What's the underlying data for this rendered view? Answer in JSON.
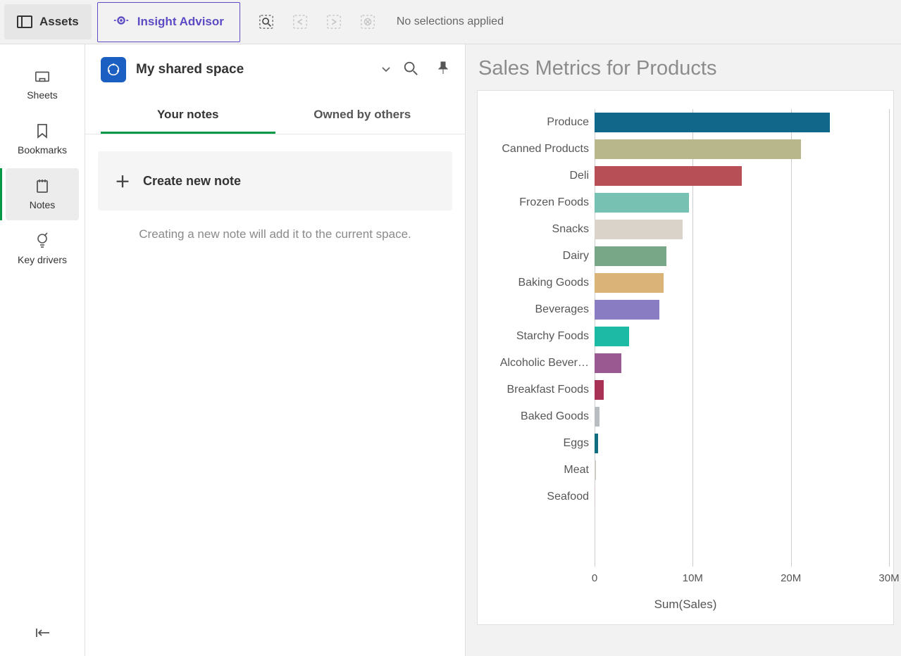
{
  "topbar": {
    "assets_label": "Assets",
    "insight_label": "Insight Advisor",
    "no_selections": "No selections applied"
  },
  "rail": {
    "items": [
      {
        "icon": "sheet-icon",
        "label": "Sheets"
      },
      {
        "icon": "bookmark-icon",
        "label": "Bookmarks"
      },
      {
        "icon": "note-icon",
        "label": "Notes"
      },
      {
        "icon": "bulb-icon",
        "label": "Key drivers"
      }
    ]
  },
  "notes": {
    "space_name": "My shared space",
    "tabs": [
      {
        "label": "Your notes"
      },
      {
        "label": "Owned by others"
      }
    ],
    "create_label": "Create new note",
    "hint": "Creating a new note will add it to the current space."
  },
  "chart_title": "Sales Metrics for Products",
  "chart_data": {
    "type": "bar",
    "orientation": "horizontal",
    "categories": [
      "Produce",
      "Canned Products",
      "Deli",
      "Frozen Foods",
      "Snacks",
      "Dairy",
      "Baking Goods",
      "Beverages",
      "Starchy Foods",
      "Alcoholic Bever…",
      "Breakfast Foods",
      "Baked Goods",
      "Eggs",
      "Meat",
      "Seafood"
    ],
    "values": [
      24000000,
      21000000,
      15000000,
      9600000,
      9000000,
      7300000,
      7000000,
      6600000,
      3500000,
      2700000,
      900000,
      500000,
      350000,
      120000,
      60000
    ],
    "colors": [
      "#11678a",
      "#b8b68b",
      "#b64f56",
      "#77c1b3",
      "#dad3ca",
      "#77a787",
      "#d9b377",
      "#8a7cc2",
      "#1dbaa5",
      "#9a5a91",
      "#a73255",
      "#b9bcc0",
      "#0f6c81",
      "#cfcbc3",
      "#d9c2c6"
    ],
    "xlabel": "Sum(Sales)",
    "xlim": [
      0,
      30000000
    ],
    "ticks": [
      0,
      10000000,
      20000000,
      30000000
    ],
    "tick_labels": [
      "0",
      "10M",
      "20M",
      "30M"
    ]
  }
}
